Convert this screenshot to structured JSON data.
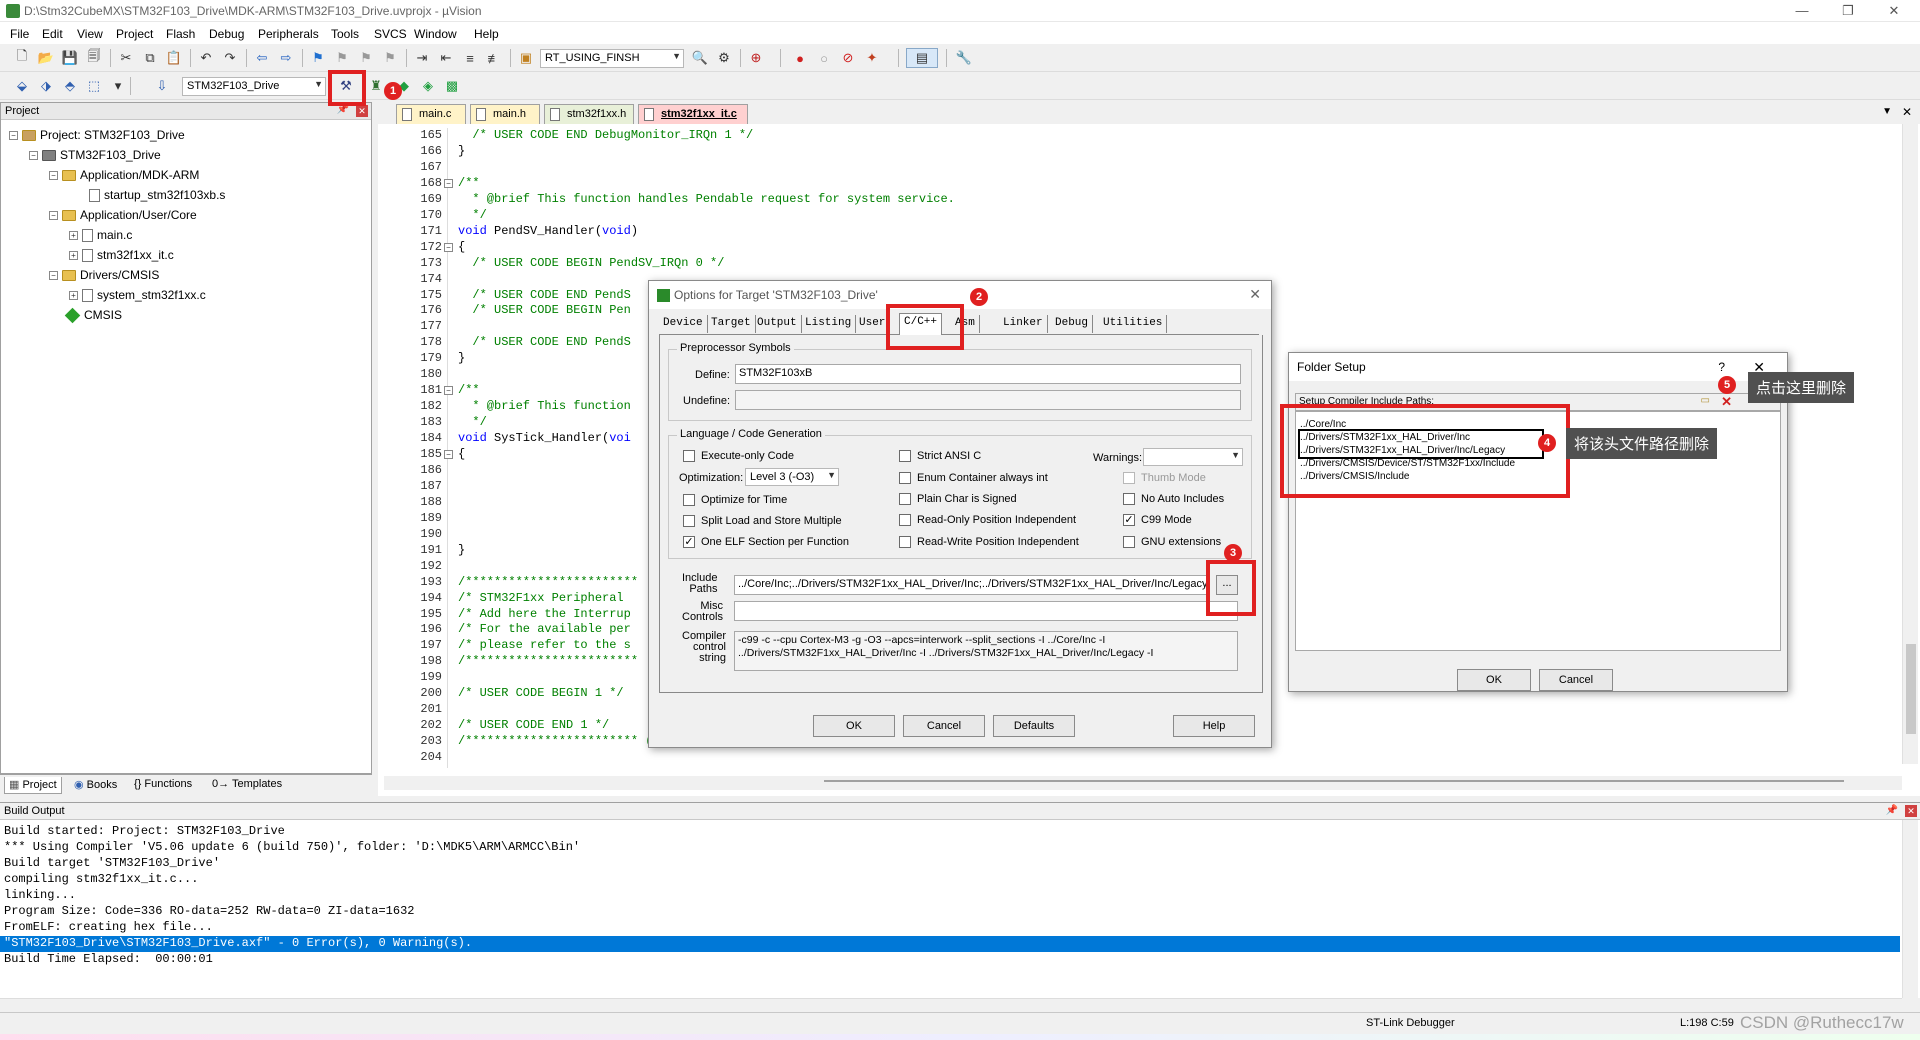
{
  "window": {
    "title": "D:\\Stm32CubeMX\\STM32F103_Drive\\MDK-ARM\\STM32F103_Drive.uvprojx - µVision",
    "minimize": "—",
    "maximize": "❐",
    "close": "✕"
  },
  "menu": [
    "File",
    "Edit",
    "View",
    "Project",
    "Flash",
    "Debug",
    "Peripherals",
    "Tools",
    "SVCS",
    "Window",
    "Help"
  ],
  "toolbar": {
    "find_combo": "RT_USING_FINSH",
    "target_combo": "STM32F103_Drive"
  },
  "project_panel": {
    "title": "Project",
    "tree": [
      {
        "label": "Project: STM32F103_Drive",
        "level": 0,
        "type": "project"
      },
      {
        "label": "STM32F103_Drive",
        "level": 1,
        "type": "target"
      },
      {
        "label": "Application/MDK-ARM",
        "level": 2,
        "type": "folder"
      },
      {
        "label": "startup_stm32f103xb.s",
        "level": 3,
        "type": "file"
      },
      {
        "label": "Application/User/Core",
        "level": 2,
        "type": "folder"
      },
      {
        "label": "main.c",
        "level": 3,
        "type": "file"
      },
      {
        "label": "stm32f1xx_it.c",
        "level": 3,
        "type": "file"
      },
      {
        "label": "Drivers/CMSIS",
        "level": 2,
        "type": "folder"
      },
      {
        "label": "system_stm32f1xx.c",
        "level": 3,
        "type": "file"
      },
      {
        "label": "CMSIS",
        "level": 2,
        "type": "component"
      }
    ],
    "tabs": [
      "Project",
      "Books",
      "{} Functions",
      "0→ Templates"
    ]
  },
  "file_tabs": [
    "main.c",
    "main.h",
    "stm32f1xx.h",
    "stm32f1xx_it.c"
  ],
  "editor": {
    "lines": [
      {
        "n": "165",
        "t": "  /* USER CODE END DebugMonitor_IRQn 1 */",
        "c": "cm"
      },
      {
        "n": "166",
        "t": "}",
        "c": ""
      },
      {
        "n": "167",
        "t": "",
        "c": ""
      },
      {
        "n": "168",
        "t": "/**",
        "c": "cm"
      },
      {
        "n": "169",
        "t": "  * @brief This function handles Pendable request for system service.",
        "c": "cm"
      },
      {
        "n": "170",
        "t": "  */",
        "c": "cm"
      },
      {
        "n": "171",
        "t": "void PendSV_Handler(void)",
        "c": "fn"
      },
      {
        "n": "172",
        "t": "{",
        "c": ""
      },
      {
        "n": "173",
        "t": "  /* USER CODE BEGIN PendSV_IRQn 0 */",
        "c": "cm"
      },
      {
        "n": "174",
        "t": "",
        "c": ""
      },
      {
        "n": "175",
        "t": "  /* USER CODE END PendS",
        "c": "cm"
      },
      {
        "n": "176",
        "t": "  /* USER CODE BEGIN Pen",
        "c": "cm"
      },
      {
        "n": "177",
        "t": "",
        "c": ""
      },
      {
        "n": "178",
        "t": "  /* USER CODE END PendS",
        "c": "cm"
      },
      {
        "n": "179",
        "t": "}",
        "c": ""
      },
      {
        "n": "180",
        "t": "",
        "c": ""
      },
      {
        "n": "181",
        "t": "/**",
        "c": "cm"
      },
      {
        "n": "182",
        "t": "  * @brief This function",
        "c": "cm"
      },
      {
        "n": "183",
        "t": "  */",
        "c": "cm"
      },
      {
        "n": "184",
        "t": "void SysTick_Handler(voi",
        "c": "fn2"
      },
      {
        "n": "185",
        "t": "{",
        "c": ""
      },
      {
        "n": "186",
        "t": "",
        "c": ""
      },
      {
        "n": "187",
        "t": "",
        "c": ""
      },
      {
        "n": "188",
        "t": "",
        "c": ""
      },
      {
        "n": "189",
        "t": "",
        "c": ""
      },
      {
        "n": "190",
        "t": "",
        "c": ""
      },
      {
        "n": "191",
        "t": "}",
        "c": ""
      },
      {
        "n": "192",
        "t": "",
        "c": ""
      },
      {
        "n": "193",
        "t": "/************************",
        "c": "cm"
      },
      {
        "n": "194",
        "t": "/* STM32F1xx Peripheral",
        "c": "cm"
      },
      {
        "n": "195",
        "t": "/* Add here the Interrup",
        "c": "cm"
      },
      {
        "n": "196",
        "t": "/* For the available per",
        "c": "cm"
      },
      {
        "n": "197",
        "t": "/* please refer to the s",
        "c": "cm"
      },
      {
        "n": "198",
        "t": "/************************",
        "c": "cm"
      },
      {
        "n": "199",
        "t": "",
        "c": ""
      },
      {
        "n": "200",
        "t": "/* USER CODE BEGIN 1 */",
        "c": "cm"
      },
      {
        "n": "201",
        "t": "",
        "c": ""
      },
      {
        "n": "202",
        "t": "/* USER CODE END 1 */",
        "c": "cm"
      },
      {
        "n": "203",
        "t": "/************************ (C) COPYRIGHT STMicroelectronics *****END OF FILE****/",
        "c": "cm"
      },
      {
        "n": "204",
        "t": "",
        "c": ""
      }
    ]
  },
  "options_dialog": {
    "title": "Options for Target 'STM32F103_Drive'",
    "tabs": [
      "Device",
      "Target",
      "Output",
      "Listing",
      "User",
      "C/C++",
      "Asm",
      "Linker",
      "Debug",
      "Utilities"
    ],
    "preprocessor": {
      "group": "Preprocessor Symbols",
      "define_label": "Define:",
      "define_value": "STM32F103xB",
      "undefine_label": "Undefine:",
      "undefine_value": ""
    },
    "language": {
      "group": "Language / Code Generation",
      "execute_only": "Execute-only Code",
      "optimization_label": "Optimization:",
      "optimization_value": "Level 3 (-O3)",
      "optimize_time": "Optimize for Time",
      "split_load": "Split Load and Store Multiple",
      "one_elf": "One ELF Section per Function",
      "strict_ansi": "Strict ANSI C",
      "enum_container": "Enum Container always int",
      "plain_char": "Plain Char is Signed",
      "ro_pi": "Read-Only Position Independent",
      "rw_pi": "Read-Write Position Independent",
      "warnings_label": "Warnings:",
      "warnings_value": "",
      "thumb_mode": "Thumb Mode",
      "no_auto_includes": "No Auto Includes",
      "c99_mode": "C99 Mode",
      "gnu_extensions": "GNU extensions"
    },
    "include_paths_label": "Include\nPaths",
    "include_paths_value": "../Core/Inc;../Drivers/STM32F1xx_HAL_Driver/Inc;../Drivers/STM32F1xx_HAL_Driver/Inc/Legacy",
    "browse": "...",
    "misc_label": "Misc\nControls",
    "misc_value": "",
    "compiler_label": "Compiler\ncontrol\nstring",
    "compiler_value": "-c99 -c --cpu Cortex-M3 -g -O3 --apcs=interwork --split_sections -I ../Core/Inc -I\n../Drivers/STM32F1xx_HAL_Driver/Inc -I ../Drivers/STM32F1xx_HAL_Driver/Inc/Legacy -I",
    "buttons": [
      "OK",
      "Cancel",
      "Defaults",
      "Help"
    ]
  },
  "folder_dialog": {
    "title": "Folder Setup",
    "help": "?",
    "close": "✕",
    "list_header": "Setup Compiler Include Paths:",
    "paths": [
      "../Core/Inc",
      "../Drivers/STM32F1xx_HAL_Driver/Inc",
      "../Drivers/STM32F1xx_HAL_Driver/Inc/Legacy",
      "../Drivers/CMSIS/Device/ST/STM32F1xx/Include",
      "../Drivers/CMSIS/Include"
    ],
    "ok": "OK",
    "cancel": "Cancel"
  },
  "annotations": {
    "badges": [
      "1",
      "2",
      "3",
      "4",
      "5"
    ],
    "callout_delete": "点击这里删除",
    "callout_paths": "将该头文件路径删除"
  },
  "build_output": {
    "title": "Build Output",
    "lines": [
      "Build started: Project: STM32F103_Drive",
      "*** Using Compiler 'V5.06 update 6 (build 750)', folder: 'D:\\MDK5\\ARM\\ARMCC\\Bin'",
      "Build target 'STM32F103_Drive'",
      "compiling stm32f1xx_it.c...",
      "linking...",
      "Program Size: Code=336 RO-data=252 RW-data=0 ZI-data=1632",
      "FromELF: creating hex file...",
      "\"STM32F103_Drive\\STM32F103_Drive.axf\" - 0 Error(s), 0 Warning(s).",
      "Build Time Elapsed:  00:00:01"
    ],
    "highlight_index": 7
  },
  "status": {
    "debugger": "ST-Link Debugger",
    "position": "L:198 C:59",
    "watermark": "CSDN @Ruthecc17w"
  },
  "colors": {
    "highlight": "#0078d7",
    "annotation_red": "#e02020",
    "comment": "#008000",
    "keyword": "#0000ff"
  }
}
